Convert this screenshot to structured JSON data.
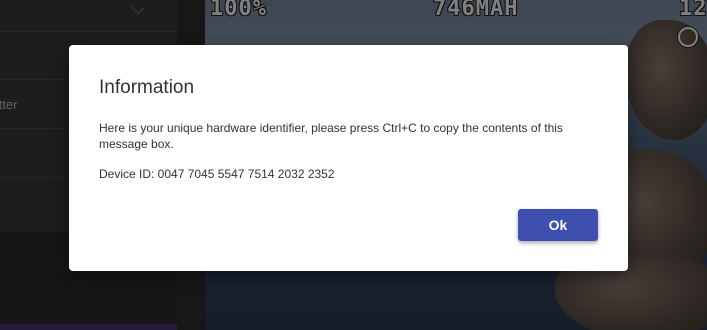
{
  "sidebar": {
    "items": [
      {
        "label": ""
      },
      {
        "label": ""
      },
      {
        "label": "ansmitter"
      },
      {
        "label": ""
      },
      {
        "label": ""
      }
    ]
  },
  "osd": {
    "battery": "100%",
    "capacity": "746MAH",
    "right_value": "12"
  },
  "dialog": {
    "title": "Information",
    "message": "Here is your unique hardware identifier, please press Ctrl+C to copy the contents of this message box.",
    "device_id": "Device ID: 0047 7045 5547 7514 2032 2352",
    "ok_label": "Ok",
    "accent_color": "#3f4fb0"
  }
}
